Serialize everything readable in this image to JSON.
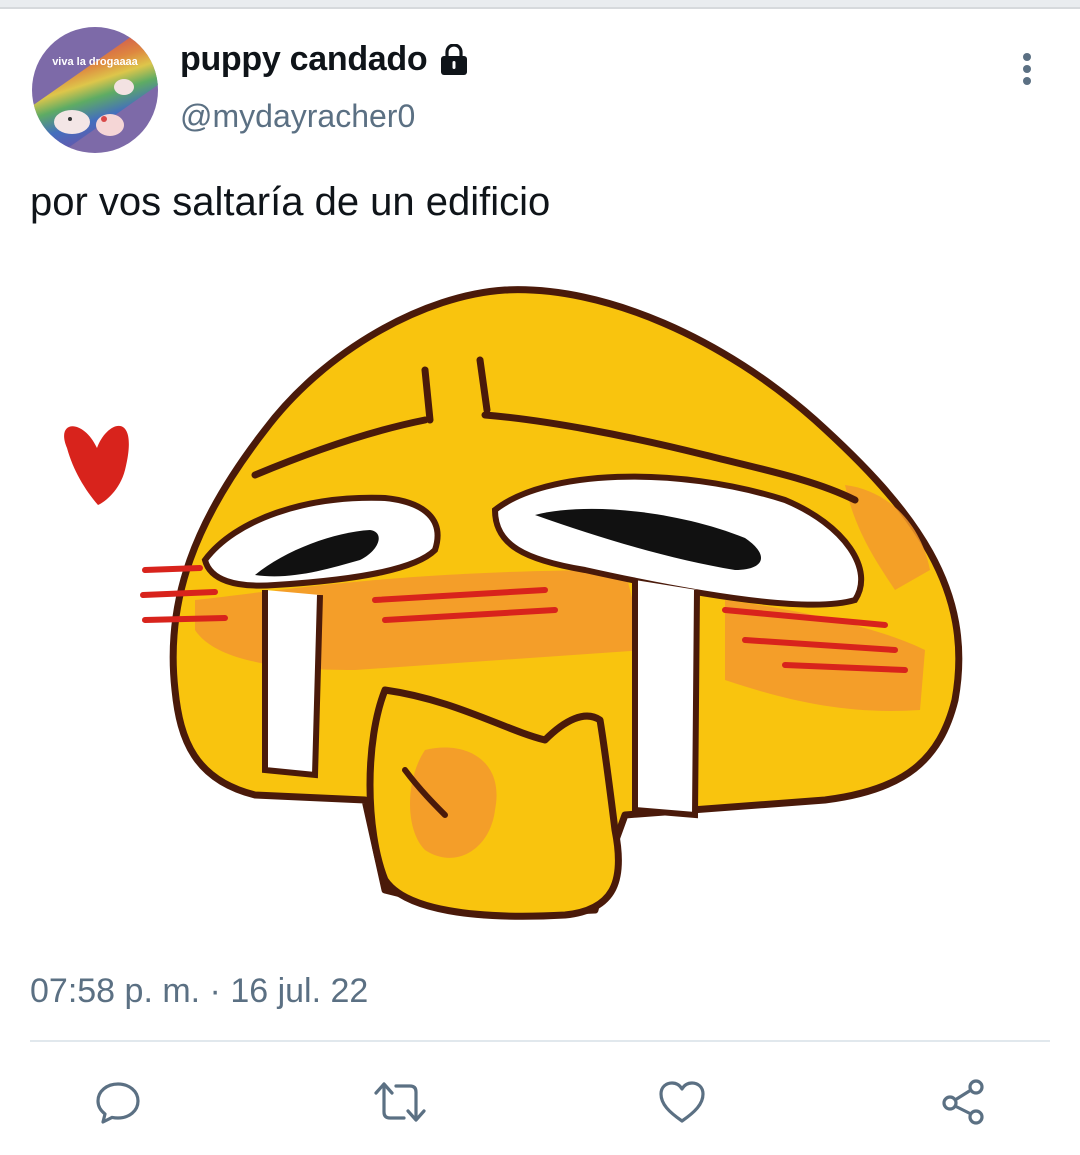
{
  "tweet": {
    "avatar_caption": "viva la drogaaaa",
    "display_name": "puppy candado",
    "handle": "@mydayracher0",
    "text": "por vos saltaría de un edificio",
    "timestamp": "07:58 p. m. · 16 jul. 22",
    "protected_icon": "lock-icon",
    "media_description_icon": "crying-emoji-drawing"
  },
  "actions": [
    {
      "name": "reply",
      "icon": "comment-icon"
    },
    {
      "name": "retweet",
      "icon": "retweet-icon"
    },
    {
      "name": "like",
      "icon": "heart-icon"
    },
    {
      "name": "share",
      "icon": "share-icon"
    }
  ],
  "colors": {
    "text": "#0f1419",
    "secondary": "#5b7083",
    "divider": "#e1e8ed",
    "emoji_yellow": "#f9c40e",
    "emoji_orange": "#f39a2c",
    "heart_red": "#d8231c"
  }
}
